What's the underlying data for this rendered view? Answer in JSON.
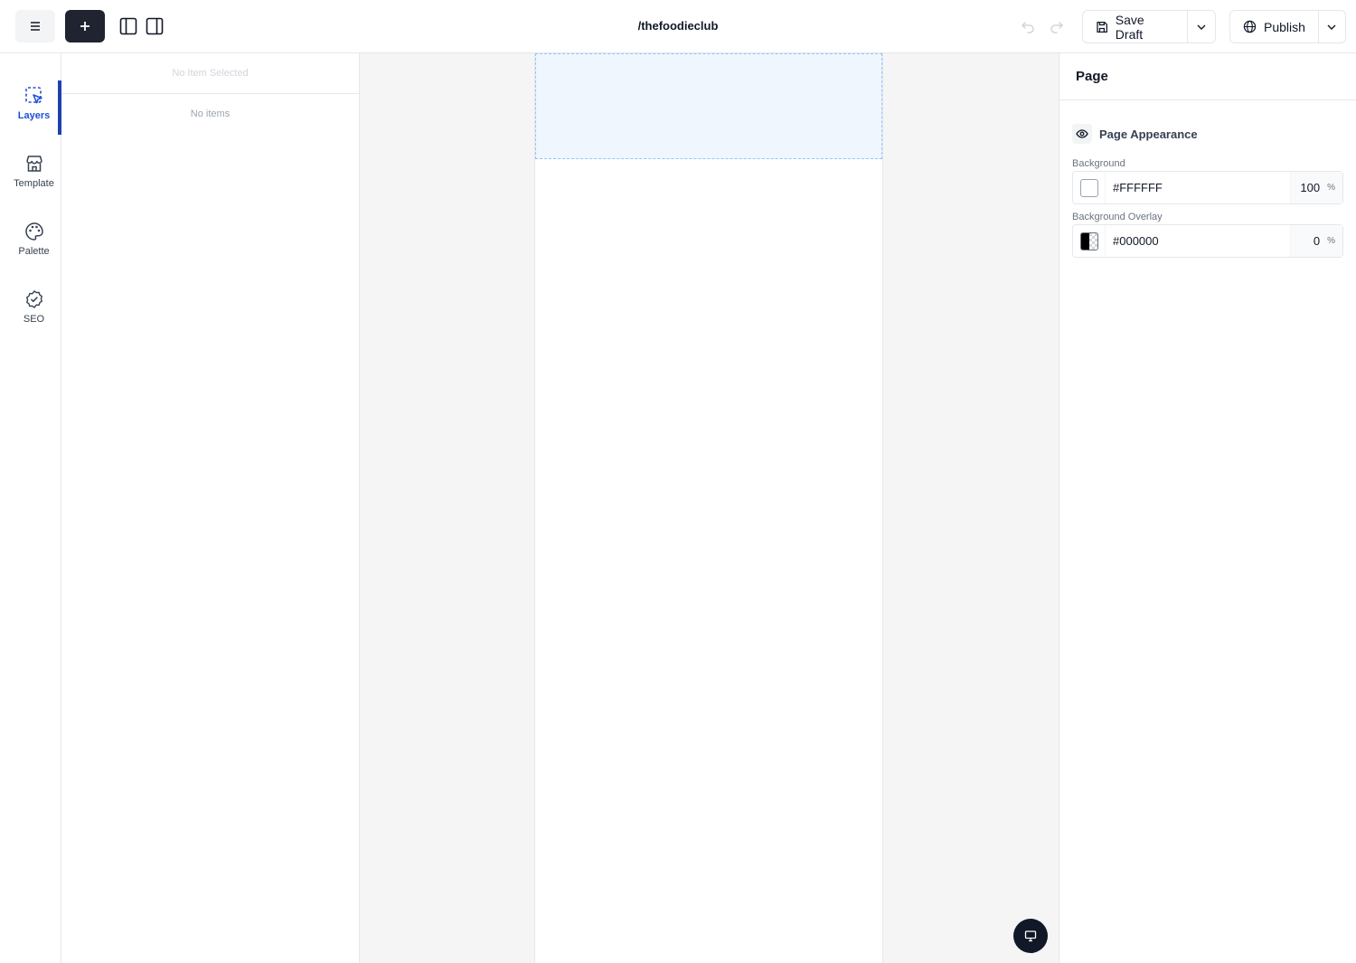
{
  "header": {
    "path": "/thefoodieclub",
    "save_label": "Save Draft",
    "publish_label": "Publish"
  },
  "rail": {
    "items": [
      {
        "label": "Layers",
        "icon": "layers-select-icon",
        "active": true
      },
      {
        "label": "Template",
        "icon": "storefront-icon",
        "active": false
      },
      {
        "label": "Palette",
        "icon": "palette-icon",
        "active": false
      },
      {
        "label": "SEO",
        "icon": "badge-check-icon",
        "active": false
      }
    ]
  },
  "layers": {
    "selected_label": "No Item Selected",
    "empty_label": "No items"
  },
  "props": {
    "title": "Page",
    "section_title": "Page Appearance",
    "background": {
      "label": "Background",
      "hex": "#FFFFFF",
      "opacity": "100",
      "unit": "%"
    },
    "overlay": {
      "label": "Background Overlay",
      "hex": "#000000",
      "opacity": "0",
      "unit": "%"
    }
  },
  "colors": {
    "accent": "#1e40af",
    "dark": "#1f2430",
    "dropzone": "#eff6fd"
  }
}
